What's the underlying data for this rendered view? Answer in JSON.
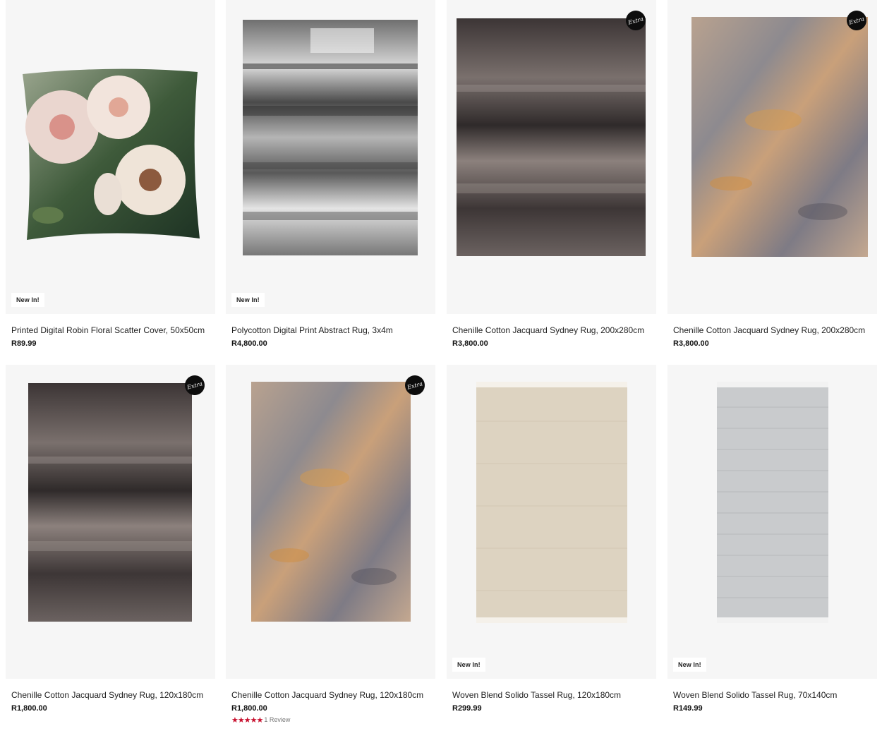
{
  "products": [
    {
      "name": "Printed Digital Robin Floral Scatter Cover, 50x50cm",
      "price": "R89.99",
      "badge": "New In!",
      "extra": "",
      "image": "floral-cushion"
    },
    {
      "name": "Polycotton Digital Print Abstract Rug, 3x4m",
      "price": "R4,800.00",
      "badge": "New In!",
      "extra": "",
      "image": "grey-abstract-rug"
    },
    {
      "name": "Chenille Cotton Jacquard Sydney Rug, 200x280cm",
      "price": "R3,800.00",
      "badge": "",
      "extra": "Extra",
      "image": "charcoal-rug"
    },
    {
      "name": "Chenille Cotton Jacquard Sydney Rug, 200x280cm",
      "price": "R3,800.00",
      "badge": "",
      "extra": "Extra",
      "image": "beige-ochre-rug"
    },
    {
      "name": "Chenille Cotton Jacquard Sydney Rug, 120x180cm",
      "price": "R1,800.00",
      "badge": "",
      "extra": "Extra",
      "image": "charcoal-rug"
    },
    {
      "name": "Chenille Cotton Jacquard Sydney Rug, 120x180cm",
      "price": "R1,800.00",
      "badge": "",
      "extra": "Extra",
      "image": "beige-ochre-rug",
      "rating": "5",
      "review_text": "1 Review"
    },
    {
      "name": "Woven Blend Solido Tassel Rug, 120x180cm",
      "price": "R299.99",
      "badge": "New In!",
      "extra": "",
      "image": "cream-tassel-rug"
    },
    {
      "name": "Woven Blend Solido Tassel Rug, 70x140cm",
      "price": "R149.99",
      "badge": "New In!",
      "extra": "",
      "image": "grey-tassel-rug"
    }
  ],
  "colors": {
    "star": "#c8102e",
    "badge_extra_bg": "#0d0d0d",
    "card_bg": "#f6f6f6"
  }
}
